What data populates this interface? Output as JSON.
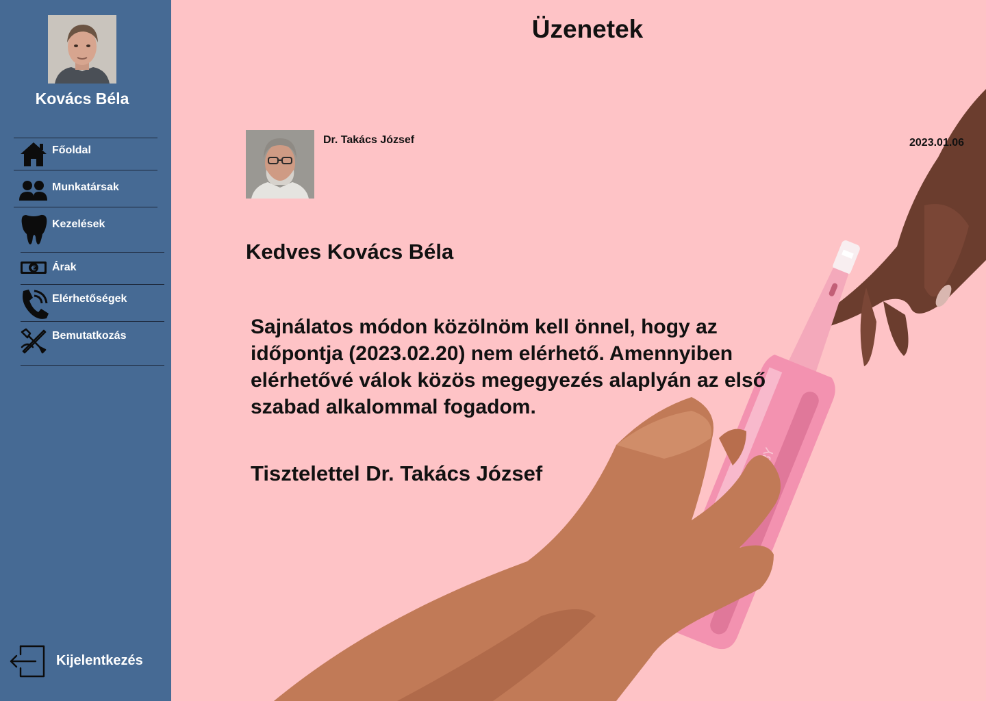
{
  "user": {
    "name": "Kovács Béla"
  },
  "nav": {
    "items": [
      {
        "label": "Főoldal",
        "icon": "home-icon"
      },
      {
        "label": "Munkatársak",
        "icon": "people-icon"
      },
      {
        "label": "Kezelések",
        "icon": "tooth-icon"
      },
      {
        "label": "Árak",
        "icon": "euro-banknote-icon"
      },
      {
        "label": "Elérhetőségek",
        "icon": "phone-icon"
      },
      {
        "label": "Bemutatkozás",
        "icon": "tools-icon"
      }
    ],
    "logout_label": "Kijelentkezés"
  },
  "page": {
    "title": "Üzenetek"
  },
  "message": {
    "sender": "Dr. Takács József",
    "date": "2023.01.06",
    "greeting": "Kedves Kovács Béla",
    "body": "Sajnálatos módon közölnöm kell önnel, hogy az időpontja (2023.02.20) nem elérhető. Amennyiben elérhetővé válok közös megegyezés alaplyán az első szabad alkalommal fogadom.",
    "signature": "Tisztelettel Dr. Takács József"
  },
  "colors": {
    "sidebar": "#466a94",
    "background": "#fec3c6",
    "text": "#111111",
    "sidebar_text": "#ffffff"
  }
}
